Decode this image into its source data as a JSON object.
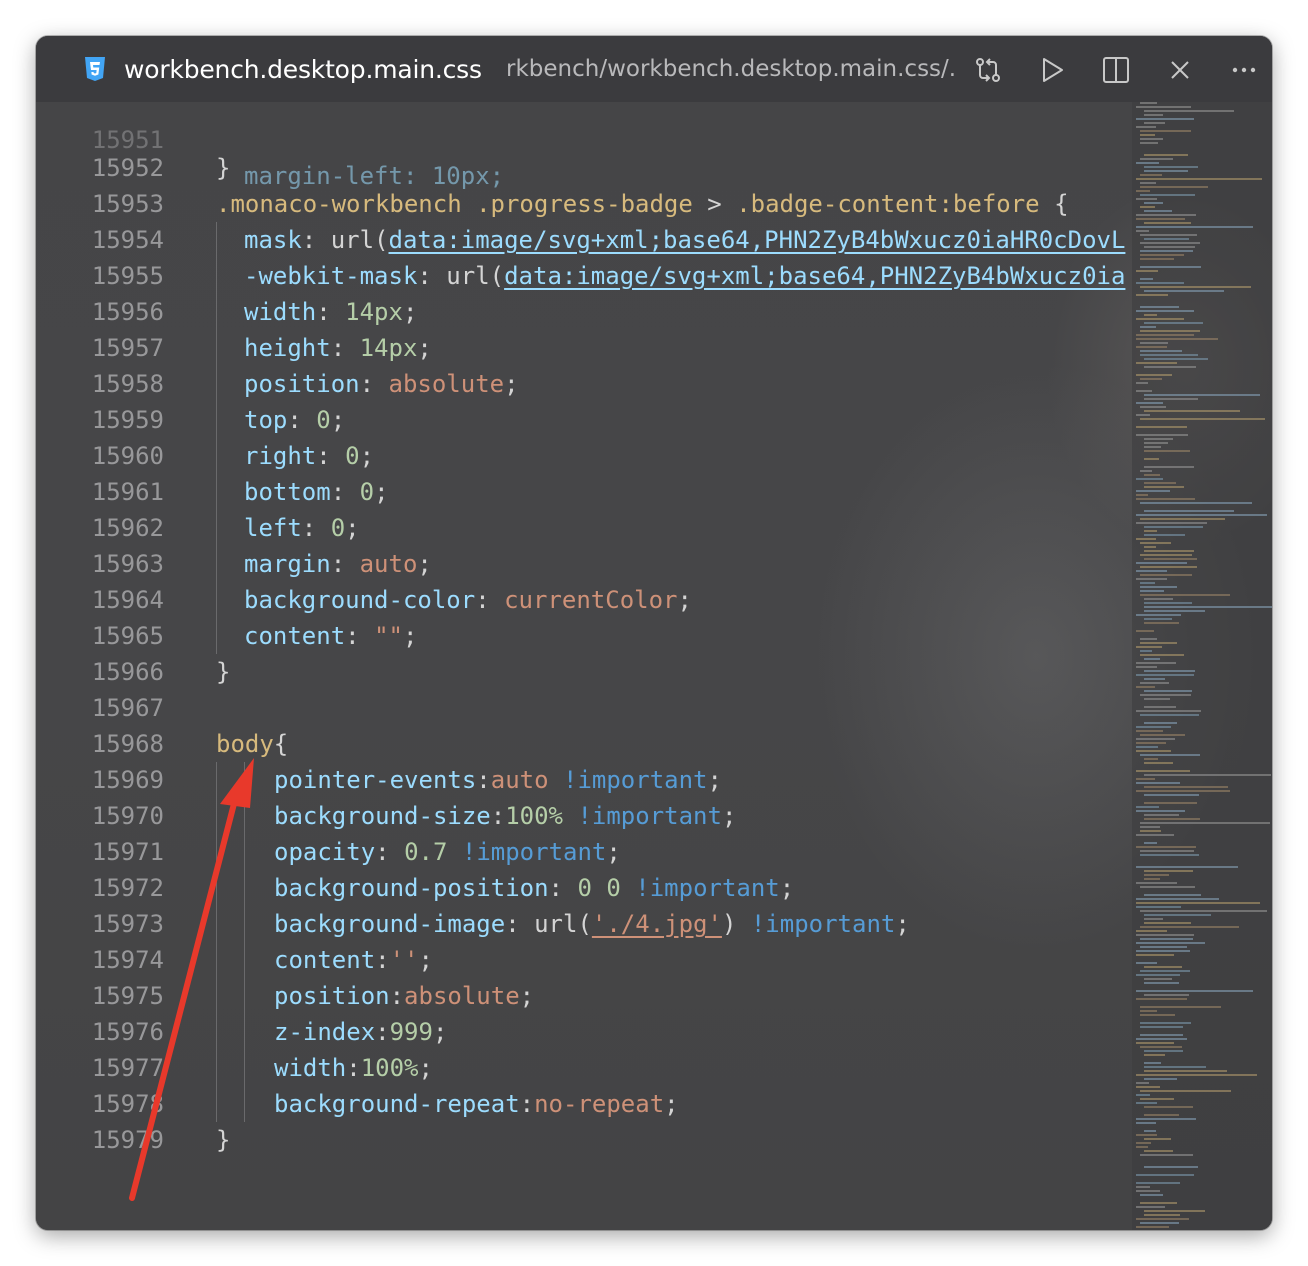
{
  "tab": {
    "filename": "workbench.desktop.main.css",
    "path": "rkbench/workbench.desktop.main.css/..."
  },
  "toolbar": {
    "compare_icon": "git-compare-icon",
    "run_icon": "play-icon",
    "split_icon": "split-editor-icon",
    "close_icon": "close-icon",
    "more_icon": "more-actions-icon"
  },
  "colors": {
    "selector": "#d7ba7d",
    "property": "#9cdcfe",
    "number": "#b5cea8",
    "value": "#ce9178",
    "keyword": "#569cd6",
    "arrow": "#e8392b"
  },
  "editor": {
    "partial_top_line": "margin-left: 10px;",
    "lines": [
      {
        "n": "15952",
        "t": "}"
      },
      {
        "n": "15953",
        "t": ".monaco-workbench .progress-badge > .badge-content:before {"
      },
      {
        "n": "15954",
        "p": "mask",
        "u": "data:image/svg+xml;base64,PHN2ZyB4bWxucz0iaHR0cDovL"
      },
      {
        "n": "15955",
        "p": "-webkit-mask",
        "u": "data:image/svg+xml;base64,PHN2ZyB4bWxucz0ia"
      },
      {
        "n": "15956",
        "p": "width",
        "v": "14px"
      },
      {
        "n": "15957",
        "p": "height",
        "v": "14px"
      },
      {
        "n": "15958",
        "p": "position",
        "v": "absolute"
      },
      {
        "n": "15959",
        "p": "top",
        "v": "0"
      },
      {
        "n": "15960",
        "p": "right",
        "v": "0"
      },
      {
        "n": "15961",
        "p": "bottom",
        "v": "0"
      },
      {
        "n": "15962",
        "p": "left",
        "v": "0"
      },
      {
        "n": "15963",
        "p": "margin",
        "v": "auto"
      },
      {
        "n": "15964",
        "p": "background-color",
        "v": "currentColor"
      },
      {
        "n": "15965",
        "p": "content",
        "v": "\"\""
      },
      {
        "n": "15966",
        "t": "}"
      },
      {
        "n": "15967",
        "t": ""
      },
      {
        "n": "15968",
        "t": "body{"
      },
      {
        "n": "15969",
        "p": "pointer-events",
        "v": "auto",
        "imp": "!important"
      },
      {
        "n": "15970",
        "p": "background-size",
        "v": "100%",
        "imp": "!important"
      },
      {
        "n": "15971",
        "p": "opacity",
        "v": "0.7",
        "imp": "!important"
      },
      {
        "n": "15972",
        "p": "background-position",
        "v": "0 0",
        "imp": "!important"
      },
      {
        "n": "15973",
        "p": "background-image",
        "v": "'./4.jpg'",
        "imp": "!important"
      },
      {
        "n": "15974",
        "p": "content",
        "v": "''"
      },
      {
        "n": "15975",
        "p": "position",
        "v": "absolute"
      },
      {
        "n": "15976",
        "p": "z-index",
        "v": "999"
      },
      {
        "n": "15977",
        "p": "width",
        "v": "100%"
      },
      {
        "n": "15978",
        "p": "background-repeat",
        "v": "no-repeat"
      },
      {
        "n": "15979",
        "t": "}"
      }
    ]
  }
}
